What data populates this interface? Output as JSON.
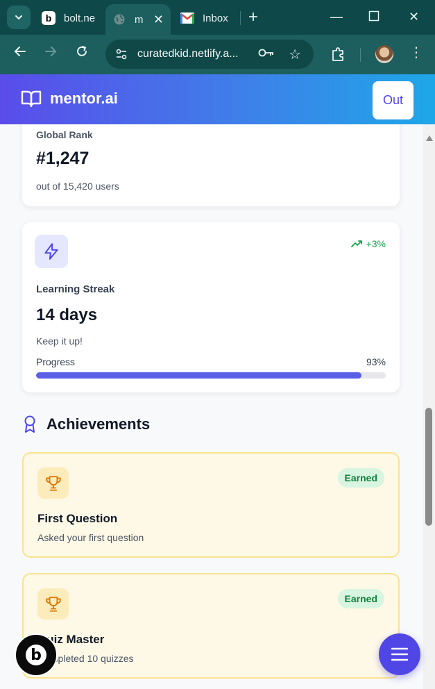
{
  "browser": {
    "tabs": [
      {
        "title": "bolt.ne",
        "favicon": "bolt-icon"
      },
      {
        "title": "m",
        "favicon": "globe-icon",
        "active": true
      },
      {
        "title": "Inbox",
        "favicon": "gmail-icon"
      }
    ],
    "url": "curatedkid.netlify.a..."
  },
  "header": {
    "brand": "mentor.ai",
    "out_label": "Out"
  },
  "rank_card": {
    "label": "Global Rank",
    "value": "#1,247",
    "sub": "out of 15,420 users"
  },
  "streak_card": {
    "trend": "+3%",
    "label": "Learning Streak",
    "value": "14 days",
    "sub": "Keep it up!",
    "progress_label": "Progress",
    "progress_pct_text": "93%",
    "progress_value": 0.93
  },
  "achievements": {
    "title": "Achievements",
    "items": [
      {
        "name": "First Question",
        "desc": "Asked your first question",
        "badge": "Earned"
      },
      {
        "name": "Quiz Master",
        "desc": "Completed 10 quizzes",
        "badge": "Earned"
      }
    ]
  },
  "colors": {
    "accent": "#4f46e5",
    "trend_green": "#16a34a",
    "achievement_bg": "#fef9e6"
  }
}
